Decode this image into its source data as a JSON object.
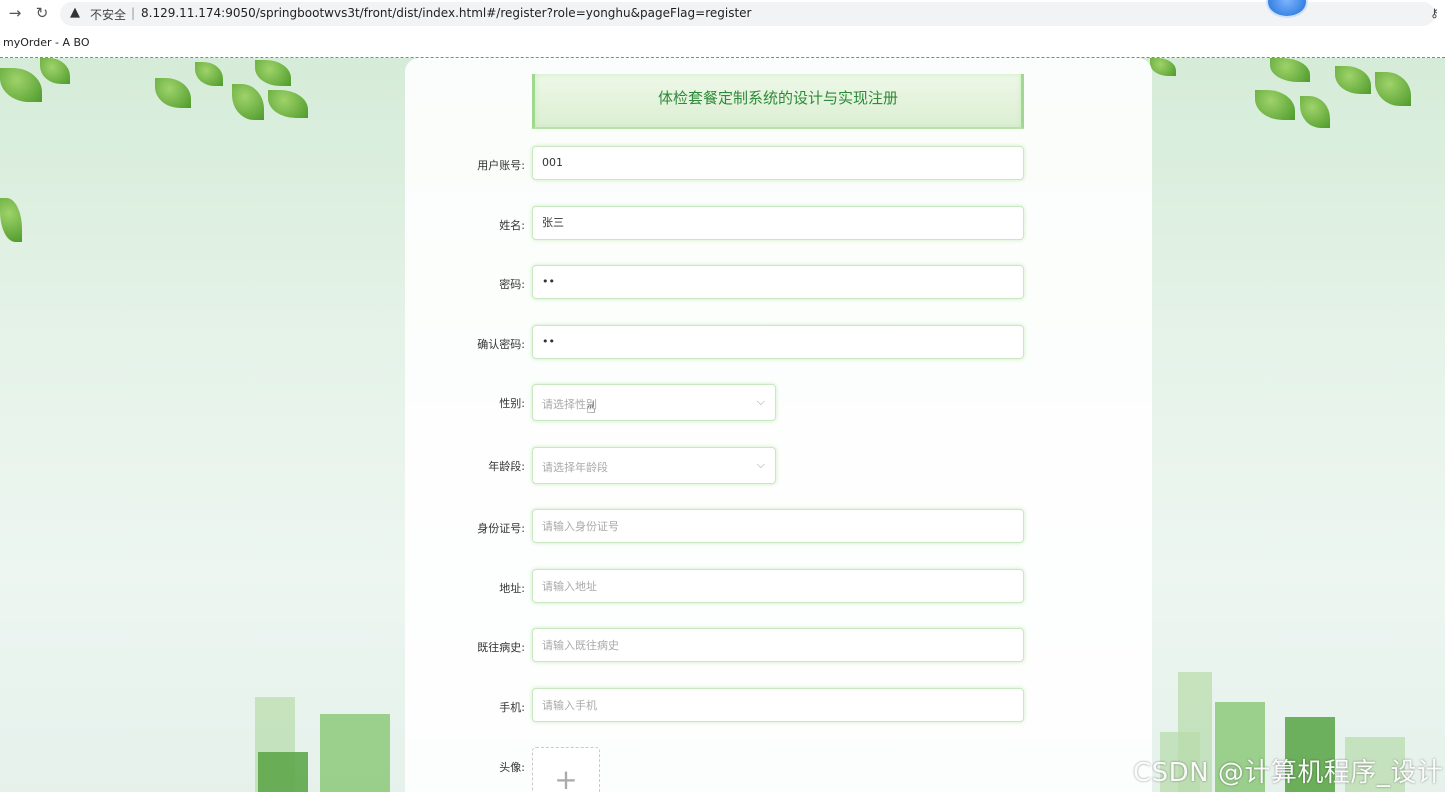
{
  "browser": {
    "security_label": "不安全",
    "separator": "|",
    "url": "8.129.11.174:9050/springbootwvs3t/front/dist/index.html#/register?role=yonghu&pageFlag=register",
    "bookmark": "myOrder - A BO"
  },
  "form": {
    "title": "体检套餐定制系统的设计与实现注册",
    "fields": {
      "account": {
        "label": "用户账号:",
        "value": "001"
      },
      "name": {
        "label": "姓名:",
        "value": "张三"
      },
      "password": {
        "label": "密码:",
        "value": "••"
      },
      "confirm": {
        "label": "确认密码:",
        "value": "••"
      },
      "gender": {
        "label": "性别:",
        "placeholder": "请选择性别"
      },
      "age_group": {
        "label": "年龄段:",
        "placeholder": "请选择年龄段"
      },
      "id_card": {
        "label": "身份证号:",
        "placeholder": "请输入身份证号"
      },
      "address": {
        "label": "地址:",
        "placeholder": "请输入地址"
      },
      "history": {
        "label": "既往病史:",
        "placeholder": "请输入既往病史"
      },
      "phone": {
        "label": "手机:",
        "placeholder": "请输入手机"
      },
      "avatar": {
        "label": "头像:"
      }
    }
  },
  "watermark": "CSDN @计算机程序_设计",
  "icons": {
    "back": "→",
    "reload": "↻",
    "warning": "▲",
    "key": "⚷",
    "chevron": "⌵",
    "plus": "+",
    "cursor": "☝"
  }
}
